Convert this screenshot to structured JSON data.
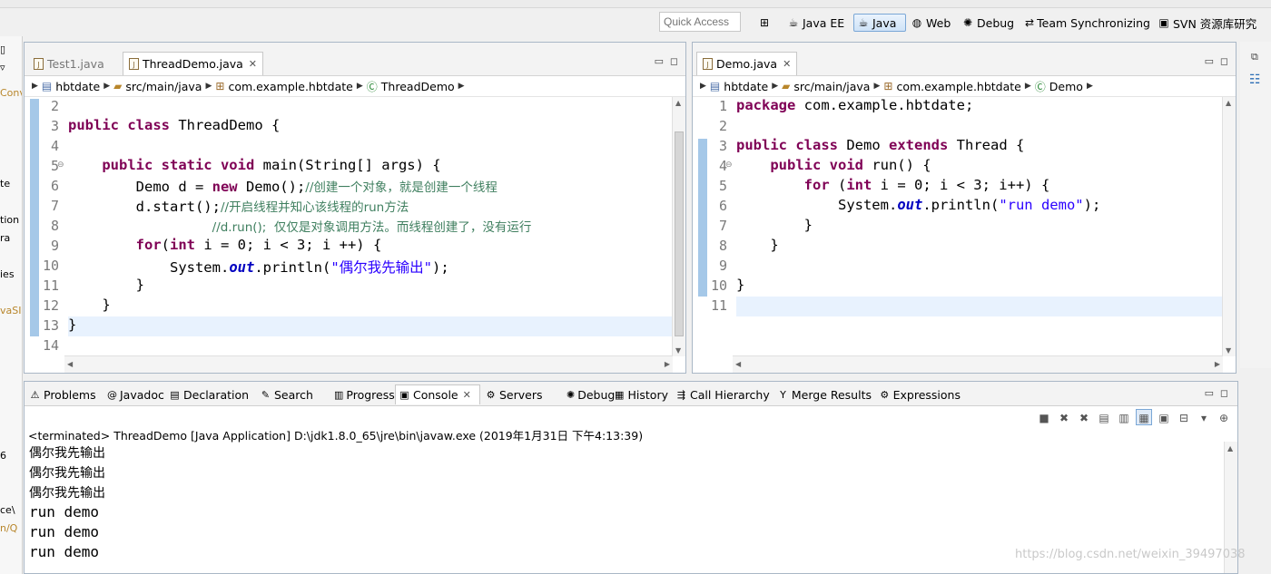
{
  "toolbar": {
    "quick_access_placeholder": "Quick Access",
    "perspectives": [
      {
        "label": "Java EE",
        "icon": "java-ee-icon",
        "active": false
      },
      {
        "label": "Java",
        "icon": "java-icon",
        "active": true
      },
      {
        "label": "Web",
        "icon": "web-icon",
        "active": false
      },
      {
        "label": "Debug",
        "icon": "debug-icon",
        "active": false
      },
      {
        "label": "Team Synchronizing",
        "icon": "team-sync-icon",
        "active": false
      },
      {
        "label": "SVN 资源库研究",
        "icon": "svn-icon",
        "active": false
      }
    ]
  },
  "left_strip": {
    "fragments": [
      "Conv",
      "te",
      "tion",
      "ra",
      "ies",
      "vaSI",
      "6",
      "ce\\",
      "n/Q"
    ]
  },
  "editor_left": {
    "tabs": [
      {
        "label": "Test1.java",
        "active": false
      },
      {
        "label": "ThreadDemo.java",
        "active": true,
        "closable": true
      }
    ],
    "breadcrumb": [
      "hbtdate",
      "src/main/java",
      "com.example.hbtdate",
      "ThreadDemo"
    ],
    "line_numbers": [
      "2",
      "3",
      "4",
      "5",
      "6",
      "7",
      "8",
      "9",
      "10",
      "11",
      "12",
      "13",
      "14"
    ],
    "lines": [
      {
        "parts": []
      },
      {
        "parts": [
          {
            "t": "public class ",
            "c": "kw"
          },
          {
            "t": "ThreadDemo {"
          }
        ]
      },
      {
        "parts": []
      },
      {
        "parts": [
          {
            "t": "    "
          },
          {
            "t": "public static void ",
            "c": "kw"
          },
          {
            "t": "main(String[] args) {"
          }
        ]
      },
      {
        "parts": [
          {
            "t": "        Demo d = "
          },
          {
            "t": "new ",
            "c": "kw"
          },
          {
            "t": "Demo();"
          },
          {
            "t": "//创建一个对象，就是创建一个线程",
            "c": "cm"
          }
        ]
      },
      {
        "parts": [
          {
            "t": "        d.start();"
          },
          {
            "t": "//开启线程并知心该线程的run方法",
            "c": "cm"
          }
        ]
      },
      {
        "parts": [
          {
            "t": "                 "
          },
          {
            "t": "//d.run();  仅仅是对象调用方法。而线程创建了，没有运行",
            "c": "cm"
          }
        ]
      },
      {
        "parts": [
          {
            "t": "        "
          },
          {
            "t": "for",
            "c": "kw"
          },
          {
            "t": "("
          },
          {
            "t": "int ",
            "c": "kw"
          },
          {
            "t": "i = 0; i < 3; i ++) {"
          }
        ]
      },
      {
        "parts": [
          {
            "t": "            System."
          },
          {
            "t": "out",
            "c": "fld"
          },
          {
            "t": ".println("
          },
          {
            "t": "\"偶尔我先输出\"",
            "c": "st"
          },
          {
            "t": ");"
          }
        ]
      },
      {
        "parts": [
          {
            "t": "        }"
          }
        ]
      },
      {
        "parts": [
          {
            "t": "    }"
          }
        ]
      },
      {
        "parts": [
          {
            "t": "}"
          }
        ]
      },
      {
        "parts": []
      }
    ]
  },
  "editor_right": {
    "tabs": [
      {
        "label": "Demo.java",
        "active": true,
        "closable": true
      }
    ],
    "breadcrumb": [
      "hbtdate",
      "src/main/java",
      "com.example.hbtdate",
      "Demo"
    ],
    "line_numbers": [
      "1",
      "2",
      "3",
      "4",
      "5",
      "6",
      "7",
      "8",
      "9",
      "10",
      "11"
    ],
    "lines": [
      {
        "parts": [
          {
            "t": "package ",
            "c": "kw"
          },
          {
            "t": "com.example.hbtdate;"
          }
        ]
      },
      {
        "parts": []
      },
      {
        "parts": [
          {
            "t": "public class ",
            "c": "kw"
          },
          {
            "t": "Demo "
          },
          {
            "t": "extends ",
            "c": "kw"
          },
          {
            "t": "Thread {"
          }
        ]
      },
      {
        "parts": [
          {
            "t": "    "
          },
          {
            "t": "public void ",
            "c": "kw"
          },
          {
            "t": "run() {"
          }
        ]
      },
      {
        "parts": [
          {
            "t": "        "
          },
          {
            "t": "for ",
            "c": "kw"
          },
          {
            "t": "("
          },
          {
            "t": "int ",
            "c": "kw"
          },
          {
            "t": "i = 0; i < 3; i++) {"
          }
        ]
      },
      {
        "parts": [
          {
            "t": "            System."
          },
          {
            "t": "out",
            "c": "fld"
          },
          {
            "t": ".println("
          },
          {
            "t": "\"run demo\"",
            "c": "st"
          },
          {
            "t": ");"
          }
        ]
      },
      {
        "parts": [
          {
            "t": "        }"
          }
        ]
      },
      {
        "parts": [
          {
            "t": "    }"
          }
        ]
      },
      {
        "parts": []
      },
      {
        "parts": [
          {
            "t": "}"
          }
        ]
      },
      {
        "parts": []
      }
    ]
  },
  "views": {
    "tabs": [
      {
        "label": "Problems",
        "icon": "problems-icon",
        "active": false
      },
      {
        "label": "Javadoc",
        "icon": "javadoc-icon",
        "active": false
      },
      {
        "label": "Declaration",
        "icon": "declaration-icon",
        "active": false
      },
      {
        "label": "Search",
        "icon": "search-icon",
        "active": false
      },
      {
        "label": "Progress",
        "icon": "progress-icon",
        "active": false
      },
      {
        "label": "Console",
        "icon": "console-icon",
        "active": true
      },
      {
        "label": "Servers",
        "icon": "servers-icon",
        "active": false
      },
      {
        "label": "Debug",
        "icon": "debug-icon",
        "active": false
      },
      {
        "label": "History",
        "icon": "history-icon",
        "active": false
      },
      {
        "label": "Call Hierarchy",
        "icon": "call-hierarchy-icon",
        "active": false
      },
      {
        "label": "Merge Results",
        "icon": "merge-results-icon",
        "active": false
      },
      {
        "label": "Expressions",
        "icon": "expressions-icon",
        "active": false
      }
    ]
  },
  "console": {
    "terminated_line": "<terminated> ThreadDemo [Java Application] D:\\jdk1.8.0_65\\jre\\bin\\javaw.exe (2019年1月31日 下午4:13:39)",
    "output": [
      "偶尔我先输出",
      "偶尔我先输出",
      "偶尔我先输出",
      "run demo",
      "run demo",
      "run demo"
    ]
  },
  "watermark": "https://blog.csdn.net/weixin_39497038",
  "colors": {
    "keyword": "#7f0055",
    "comment": "#3f7f5f",
    "string": "#2a00ff",
    "field": "#0000c0",
    "current_line": "#e8f2fe"
  }
}
